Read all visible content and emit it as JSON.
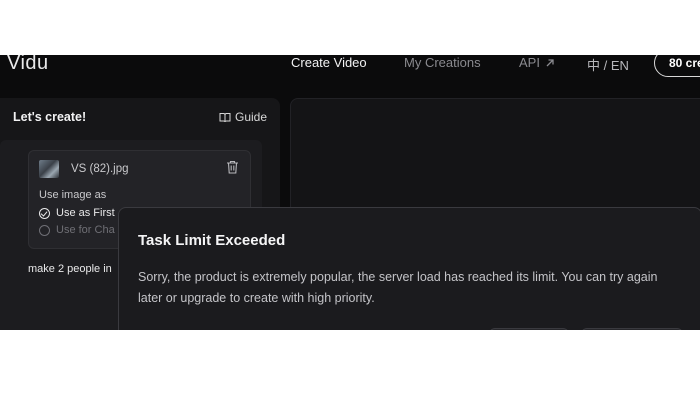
{
  "header": {
    "logo": "Vidu",
    "nav": {
      "create_video": "Create Video",
      "my_creations": "My Creations",
      "api": "API",
      "language": "中 / EN"
    },
    "credits": "80 cre"
  },
  "left_panel": {
    "title": "Let's create!",
    "guide_label": "Guide",
    "upload": {
      "file_name": "VS (82).jpg",
      "use_image_as": "Use image as",
      "option_first": "Use as First",
      "option_character": "Use for Cha"
    },
    "prompt": "make 2 people in"
  },
  "modal": {
    "title": "Task Limit Exceeded",
    "message": "Sorry, the product is extremely popular, the server load has reached its limit. You can try again later or upgrade to create with high priority."
  }
}
